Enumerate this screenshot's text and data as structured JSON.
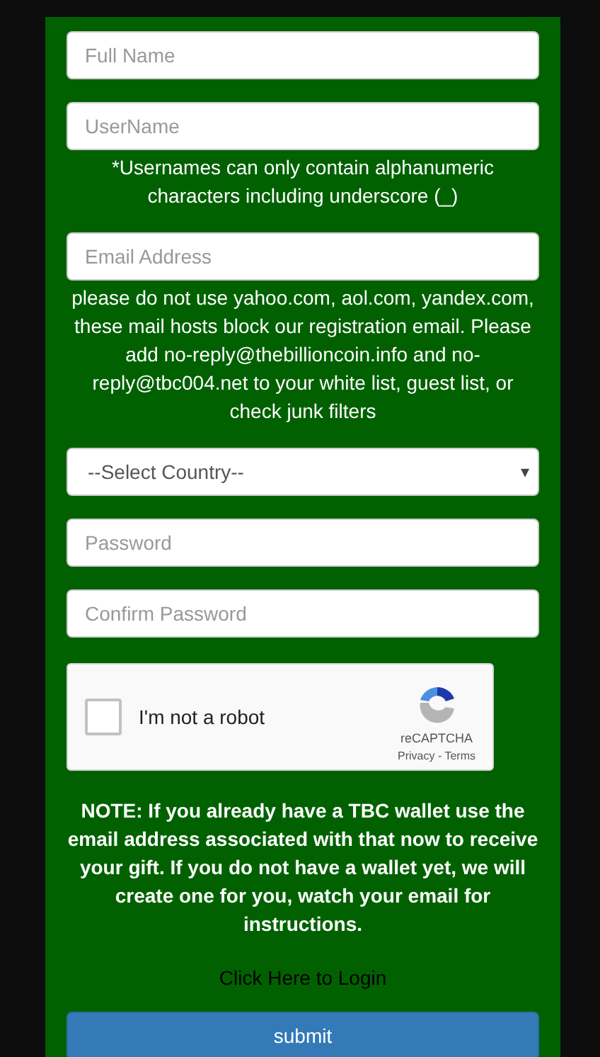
{
  "form": [
    {
      "kind": "input",
      "placeholder": "Full Name"
    },
    {
      "kind": "input",
      "placeholder": "UserName"
    },
    {
      "kind": "hint",
      "text": "*Usernames can only contain alphanumeric characters including underscore (_)"
    },
    {
      "kind": "input",
      "placeholder": "Email Address"
    },
    {
      "kind": "hint",
      "text": "please do not use yahoo.com, aol.com, yandex.com, these mail hosts block our registration email. Please add no-reply@thebillioncoin.info and no-reply@tbc004.net to your white list, guest list, or check junk filters"
    },
    {
      "kind": "select",
      "value": "--Select Country--",
      "arrow": "▾"
    },
    {
      "kind": "input",
      "placeholder": "Password"
    },
    {
      "kind": "input",
      "placeholder": "Confirm Password"
    },
    {
      "kind": "captcha",
      "label": "I'm not a robot",
      "checked": false,
      "brand": "reCAPTCHA",
      "links": "Privacy - Terms"
    }
  ],
  "note": "NOTE: If you already have a TBC wallet use the email address associated with that now to receive your gift. If you do not have a wallet yet, we will create one for you, watch your email for instructions.",
  "login_link": "Click Here to Login",
  "submit_button": "submit"
}
